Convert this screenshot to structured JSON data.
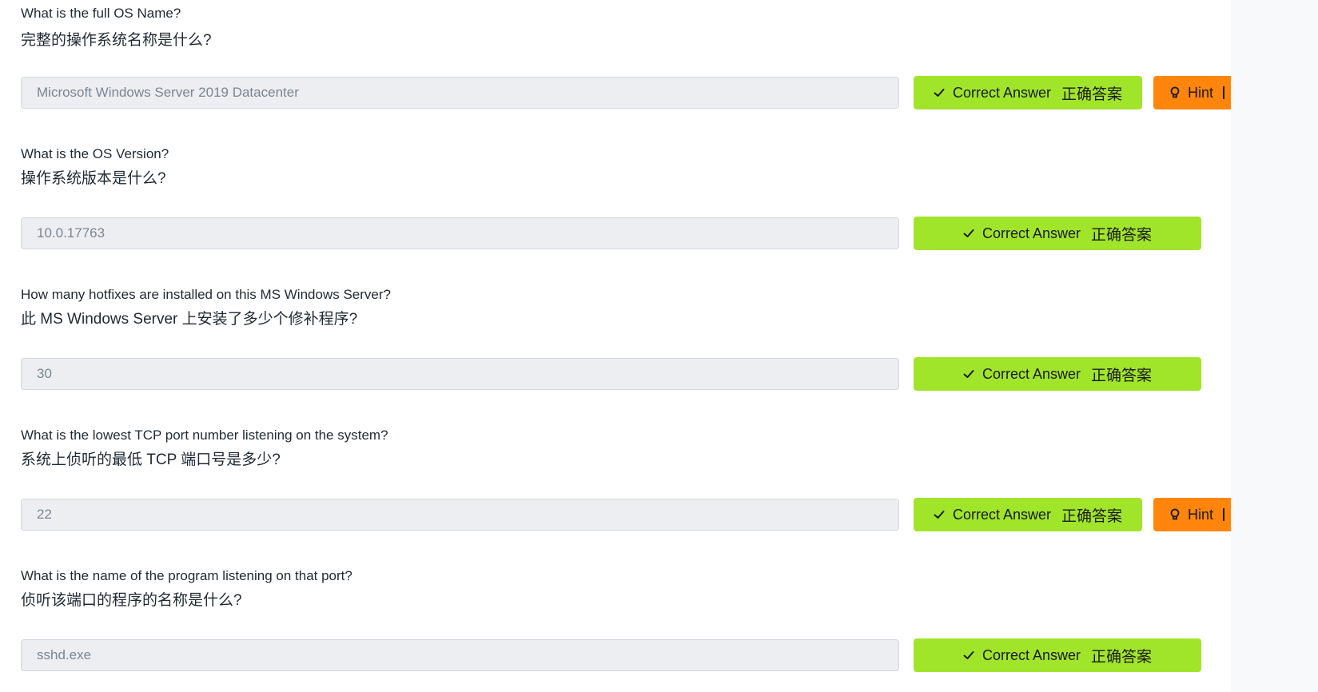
{
  "questions": [
    {
      "question_en": "What is the full OS Name?",
      "question_zh": "完整的操作系统名称是什么?",
      "answer": "Microsoft Windows Server 2019 Datacenter",
      "correct_label": "Correct Answer",
      "correct_label_zh": "正确答案",
      "hint_label": "Hint"
    },
    {
      "question_en": "What is the OS Version?",
      "question_zh": "操作系统版本是什么?",
      "answer": "10.0.17763",
      "correct_label": "Correct Answer",
      "correct_label_zh": "正确答案"
    },
    {
      "question_en": "How many hotfixes are installed on this MS Windows Server?",
      "question_zh": "此 MS Windows Server 上安装了多少个修补程序?",
      "answer": "30",
      "correct_label": "Correct Answer",
      "correct_label_zh": "正确答案"
    },
    {
      "question_en": "What is the lowest TCP port number listening on the system?",
      "question_zh": "系统上侦听的最低 TCP 端口号是多少?",
      "answer": "22",
      "correct_label": "Correct Answer",
      "correct_label_zh": "正确答案",
      "hint_label": "Hint"
    },
    {
      "question_en": "What is the name of the program listening on that port?",
      "question_zh": "侦听该端口的程序的名称是什么?",
      "answer": "sshd.exe",
      "correct_label": "Correct Answer",
      "correct_label_zh": "正确答案"
    }
  ],
  "colors": {
    "correct_button": "#a1e52b",
    "hint_button": "#ff850d",
    "answer_field_bg": "#eceef2",
    "page_bg": "#ffffff"
  },
  "icons": {
    "correct": "check-icon",
    "hint": "lightbulb-icon"
  }
}
